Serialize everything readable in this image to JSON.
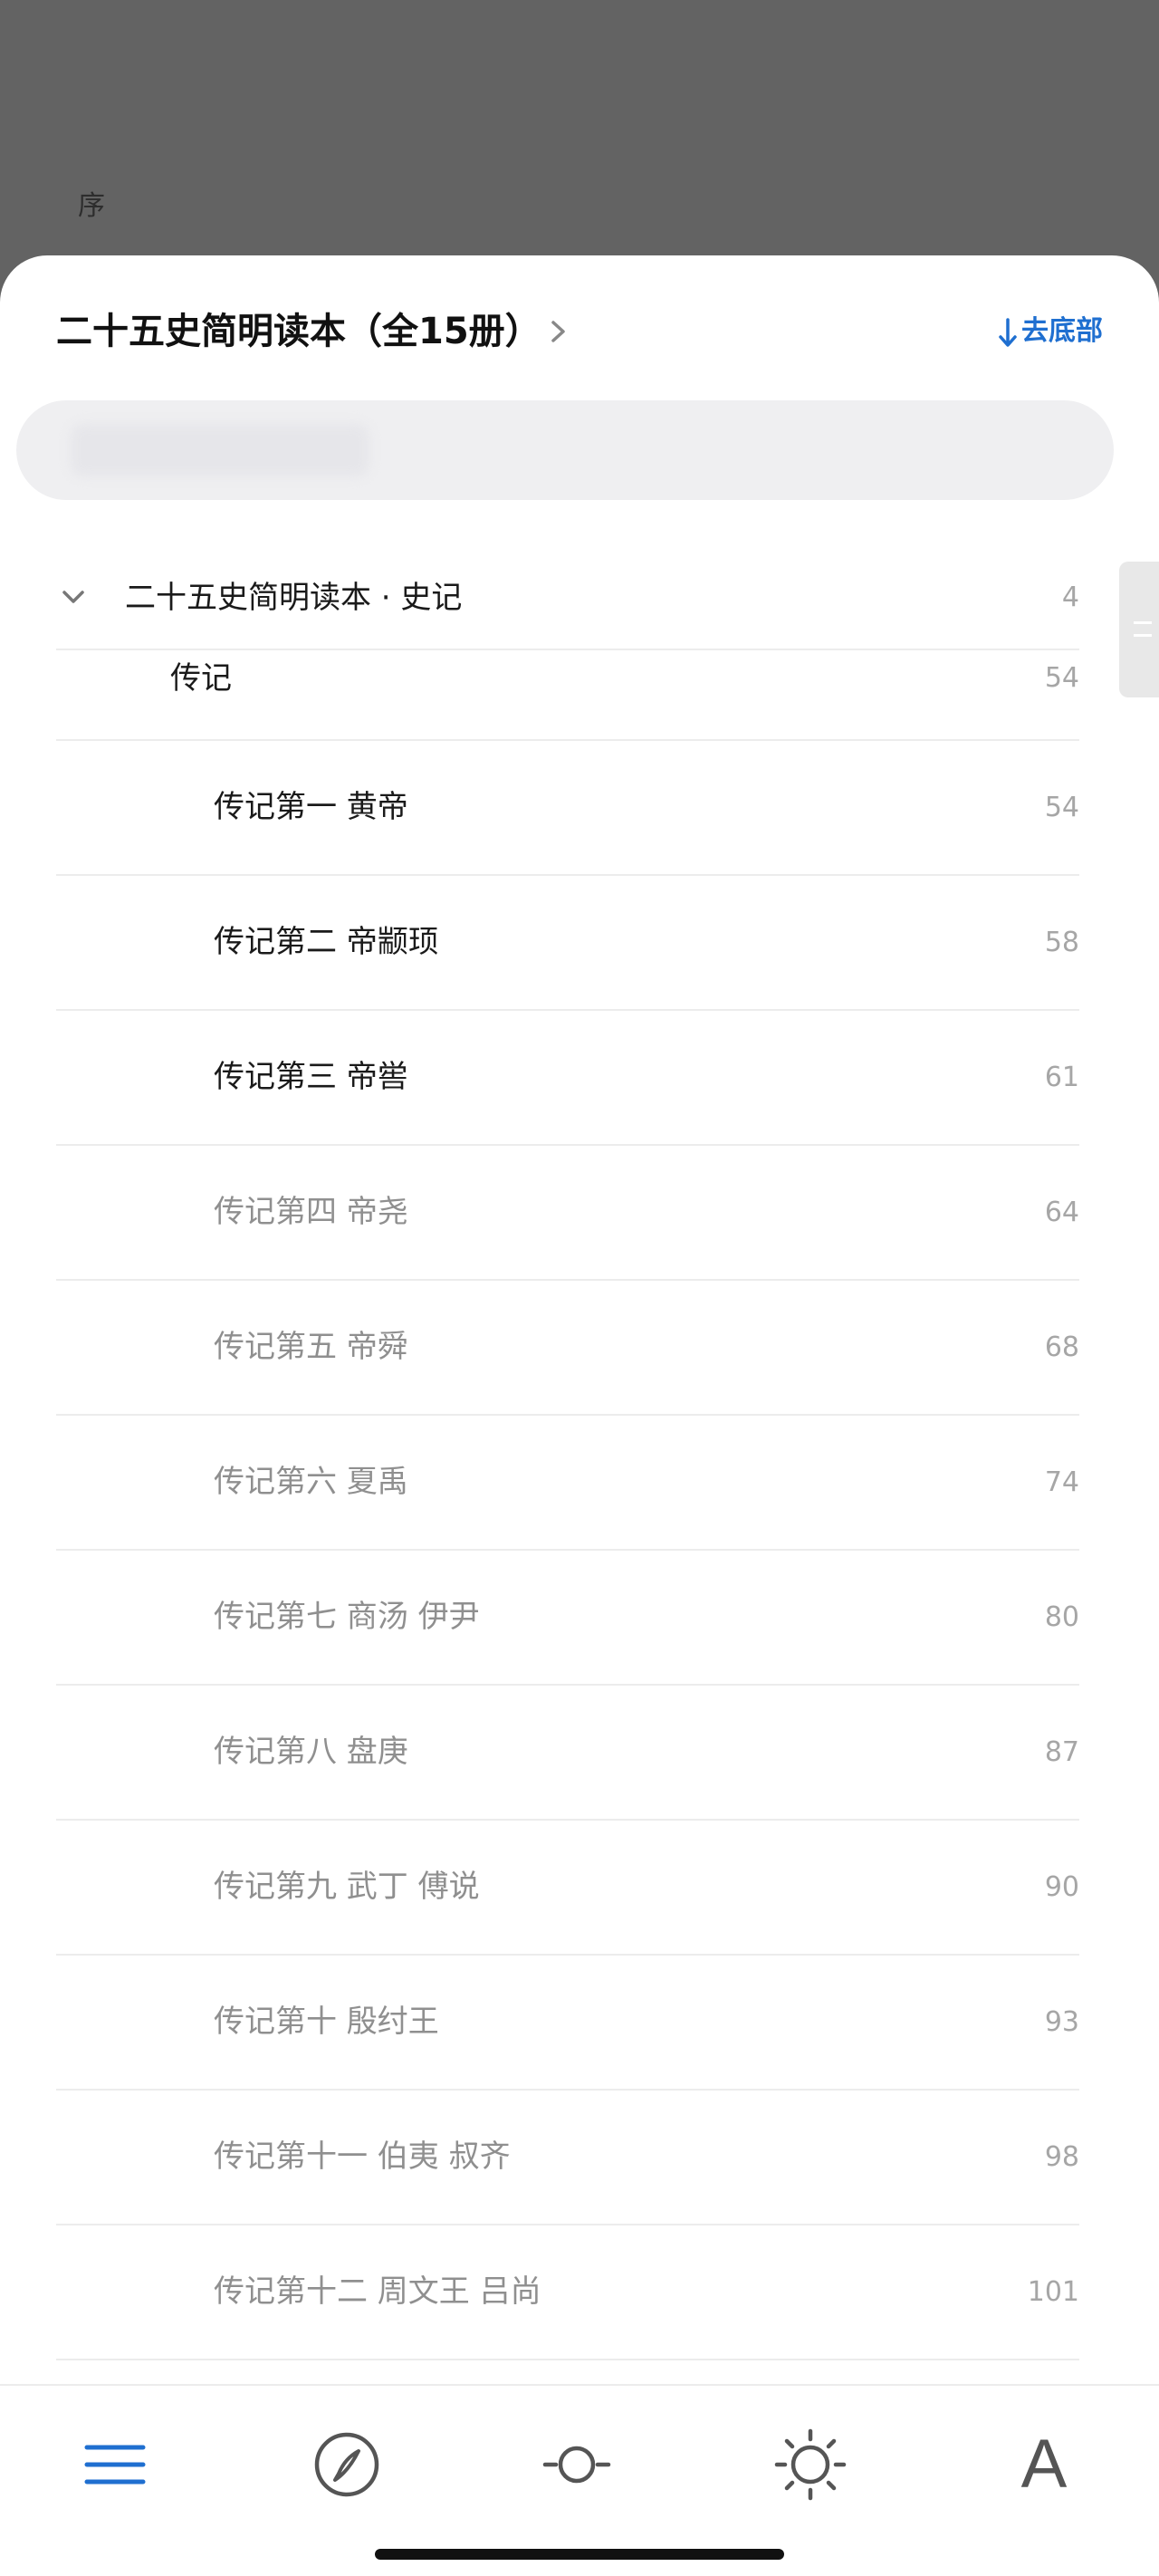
{
  "background": {
    "text": "序"
  },
  "header": {
    "book_title": "二十五史简明读本（全15册）",
    "to_bottom_label": "去底部"
  },
  "colors": {
    "accent": "#1f6fd0",
    "read_text": "#1a1a1a",
    "unread_text": "#8f8f8f"
  },
  "toc": {
    "section": {
      "label": "二十五史简明读本 · 史记",
      "page": "4"
    },
    "subsection": {
      "label": "传记",
      "page": "54"
    },
    "items": [
      {
        "label": "传记第一 黄帝",
        "page": "54",
        "state": "read"
      },
      {
        "label": "传记第二 帝颛顼",
        "page": "58",
        "state": "read"
      },
      {
        "label": "传记第三 帝喾",
        "page": "61",
        "state": "read"
      },
      {
        "label": "传记第四 帝尧",
        "page": "64",
        "state": "unread"
      },
      {
        "label": "传记第五 帝舜",
        "page": "68",
        "state": "unread"
      },
      {
        "label": "传记第六 夏禹",
        "page": "74",
        "state": "unread"
      },
      {
        "label": "传记第七 商汤 伊尹",
        "page": "80",
        "state": "unread"
      },
      {
        "label": "传记第八 盘庚",
        "page": "87",
        "state": "unread"
      },
      {
        "label": "传记第九 武丁 傅说",
        "page": "90",
        "state": "unread"
      },
      {
        "label": "传记第十 殷纣王",
        "page": "93",
        "state": "unread"
      },
      {
        "label": "传记第十一 伯夷 叔齐",
        "page": "98",
        "state": "unread"
      },
      {
        "label": "传记第十二 周文王 吕尚",
        "page": "101",
        "state": "unread"
      }
    ]
  },
  "tabbar": {
    "tabs": [
      "toc-icon",
      "compass-icon",
      "progress-icon",
      "brightness-icon",
      "font-icon"
    ],
    "font_glyph": "A"
  }
}
